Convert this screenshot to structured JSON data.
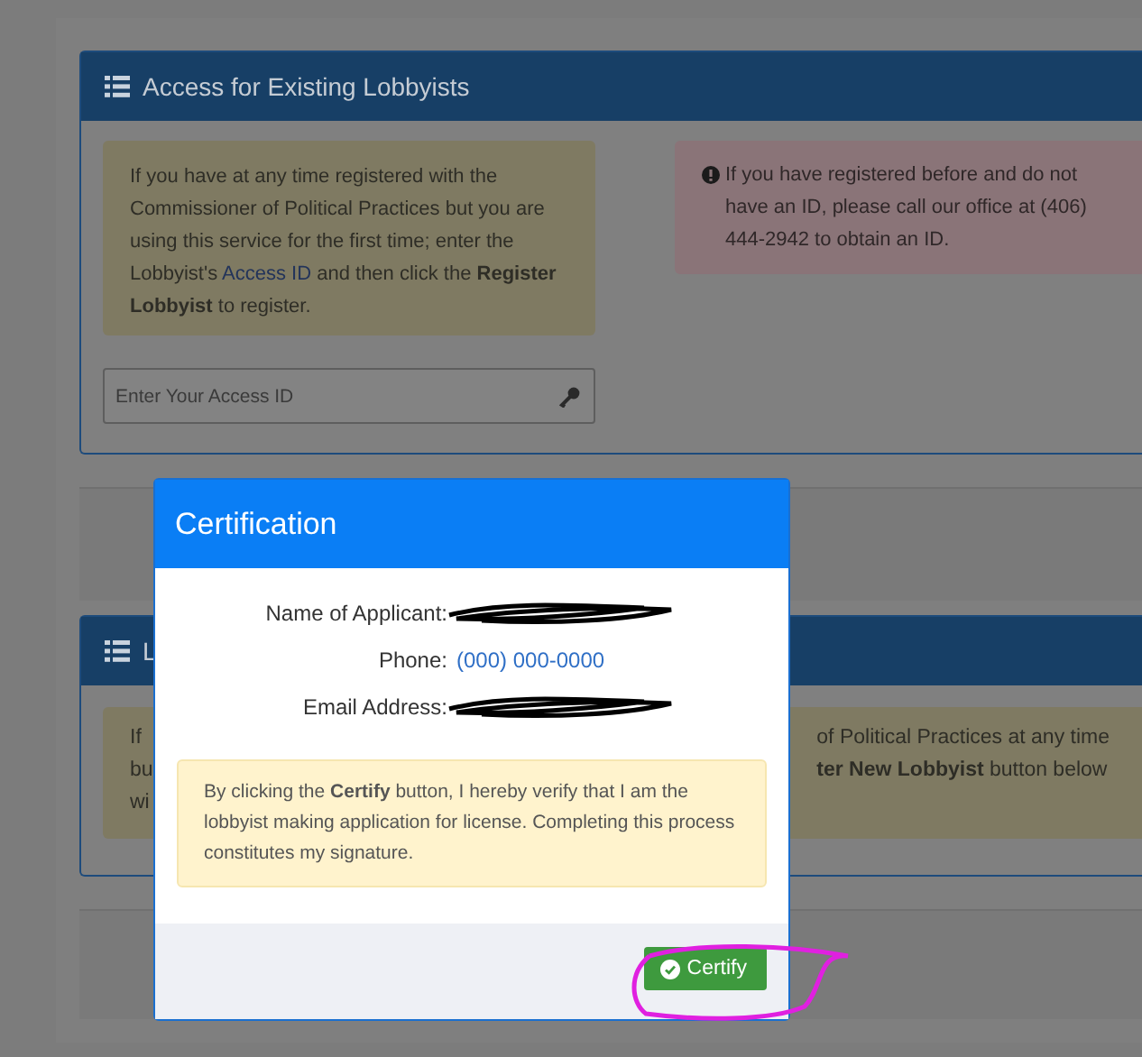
{
  "existing_card": {
    "title": "Access for Existing Lobbyists",
    "note": [
      {
        "kind": "plain",
        "text": "If you have at any time registered with the Commissioner of Political Practices but you are using this service for the first time; enter the Lobbyist's "
      },
      {
        "kind": "link",
        "text": "Access ID"
      },
      {
        "kind": "plain",
        "text": " and then click the "
      },
      {
        "kind": "bold",
        "text": "Register Lobbyist"
      },
      {
        "kind": "plain",
        "text": " to register."
      }
    ],
    "alert": "If you have registered before and do not have an ID, please call our office at (406) 444-2942 to obtain an ID.",
    "access_field": {
      "placeholder": "Enter Your Access ID"
    }
  },
  "new_card": {
    "title": "L",
    "note_left": [
      "If",
      "bu",
      "wi"
    ],
    "note_right": [
      "of Political Practices at any time",
      "**ter New Lobbyist** button below"
    ]
  },
  "modal": {
    "title": "Certification",
    "fields": [
      {
        "label": "Name of Applicant:",
        "redacted": true
      },
      {
        "label": "Phone:",
        "value": "(000) 000-0000",
        "redacted": false
      },
      {
        "label": "Email Address:",
        "redacted": true
      }
    ],
    "notice": "By clicking the **Certify** button, I hereby verify that I am the lobbyist making application for license. Completing this process constitutes my signature.",
    "button": "Certify",
    "annotated": true
  }
}
